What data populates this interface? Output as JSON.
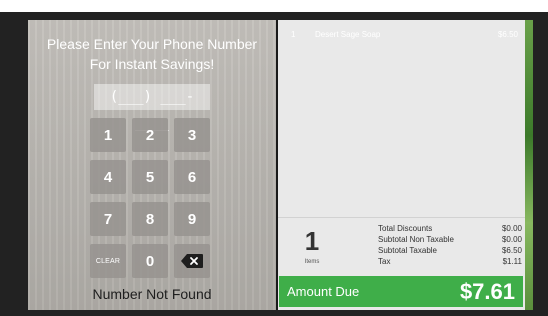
{
  "prompt": {
    "line1": "Please Enter Your Phone Number",
    "line2": "For Instant Savings!"
  },
  "phone_input": {
    "value": "(___) ___-____"
  },
  "keypad": {
    "keys": [
      "1",
      "2",
      "3",
      "4",
      "5",
      "6",
      "7",
      "8",
      "9",
      "CLEAR",
      "0"
    ],
    "backspace_icon": "backspace-icon"
  },
  "status_message": "Number Not Found",
  "cart": {
    "items": [
      {
        "qty": "1",
        "name": "Desert Sage Soap",
        "price": "$6.50"
      }
    ],
    "item_count": "1",
    "item_count_label": "Items"
  },
  "totals": {
    "labels": [
      "Total Discounts",
      "Subtotal Non Taxable",
      "Subtotal Taxable",
      "Tax"
    ],
    "values": [
      "$0.00",
      "$0.00",
      "$6.50",
      "$1.11"
    ]
  },
  "amount_due": {
    "label": "Amount Due",
    "value": "$7.61",
    "color": "#3fae49"
  }
}
